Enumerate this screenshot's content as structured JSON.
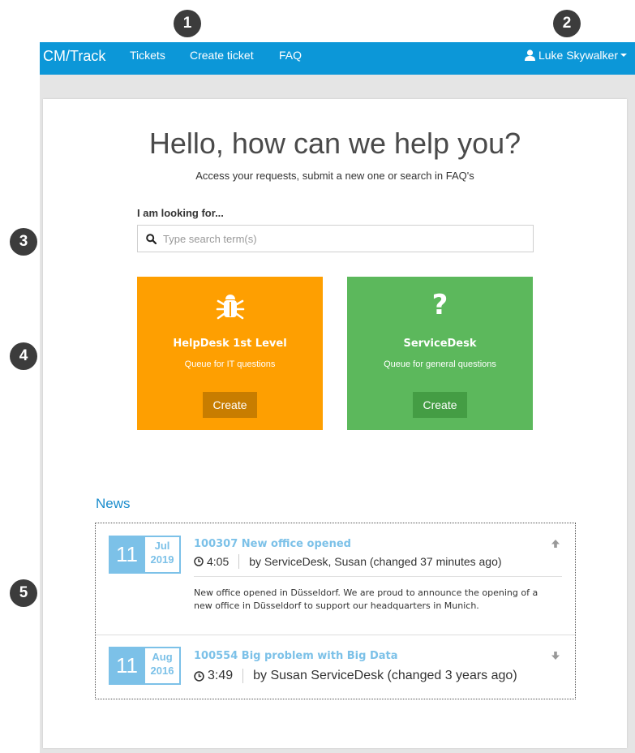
{
  "markers": [
    "1",
    "2",
    "3",
    "4",
    "5"
  ],
  "navbar": {
    "brand": "CM/Track",
    "links": [
      "Tickets",
      "Create ticket",
      "FAQ"
    ],
    "user": "Luke Skywalker"
  },
  "hero": {
    "title": "Hello, how can we help you?",
    "subtitle": "Access your requests, submit a new one or search in FAQ's"
  },
  "search": {
    "label": "I am looking for...",
    "placeholder": "Type search term(s)",
    "value": ""
  },
  "tiles": [
    {
      "icon": "bug-icon",
      "title": "HelpDesk 1st Level",
      "description": "Queue for IT questions",
      "button": "Create",
      "color": "#fe9f01"
    },
    {
      "icon": "question-icon",
      "title": "ServiceDesk",
      "description": "Queue for general questions",
      "button": "Create",
      "color": "#5cb85c"
    }
  ],
  "tile_glyphs": {
    "question": "?"
  },
  "news": {
    "title": "News",
    "items": [
      {
        "day": "11",
        "month": "Jul",
        "year": "2019",
        "title": "100307 New office opened",
        "time": "4:05",
        "byline": "by ServiceDesk, Susan (changed 37 minutes ago)",
        "body": "New office opened in Düsseldorf. We are proud to announce the opening of a new office in Düsseldorf to support our headquarters in Munich.",
        "arrow": "up"
      },
      {
        "day": "11",
        "month": "Aug",
        "year": "2016",
        "title": "100554 Big problem with Big Data",
        "time": "3:49",
        "byline": "by Susan ServiceDesk (changed 3 years ago)",
        "arrow": "down"
      }
    ]
  },
  "colors": {
    "navbar": "#0c97d8",
    "accent": "#7cc1e8",
    "news_title": "#1a8ccc"
  }
}
